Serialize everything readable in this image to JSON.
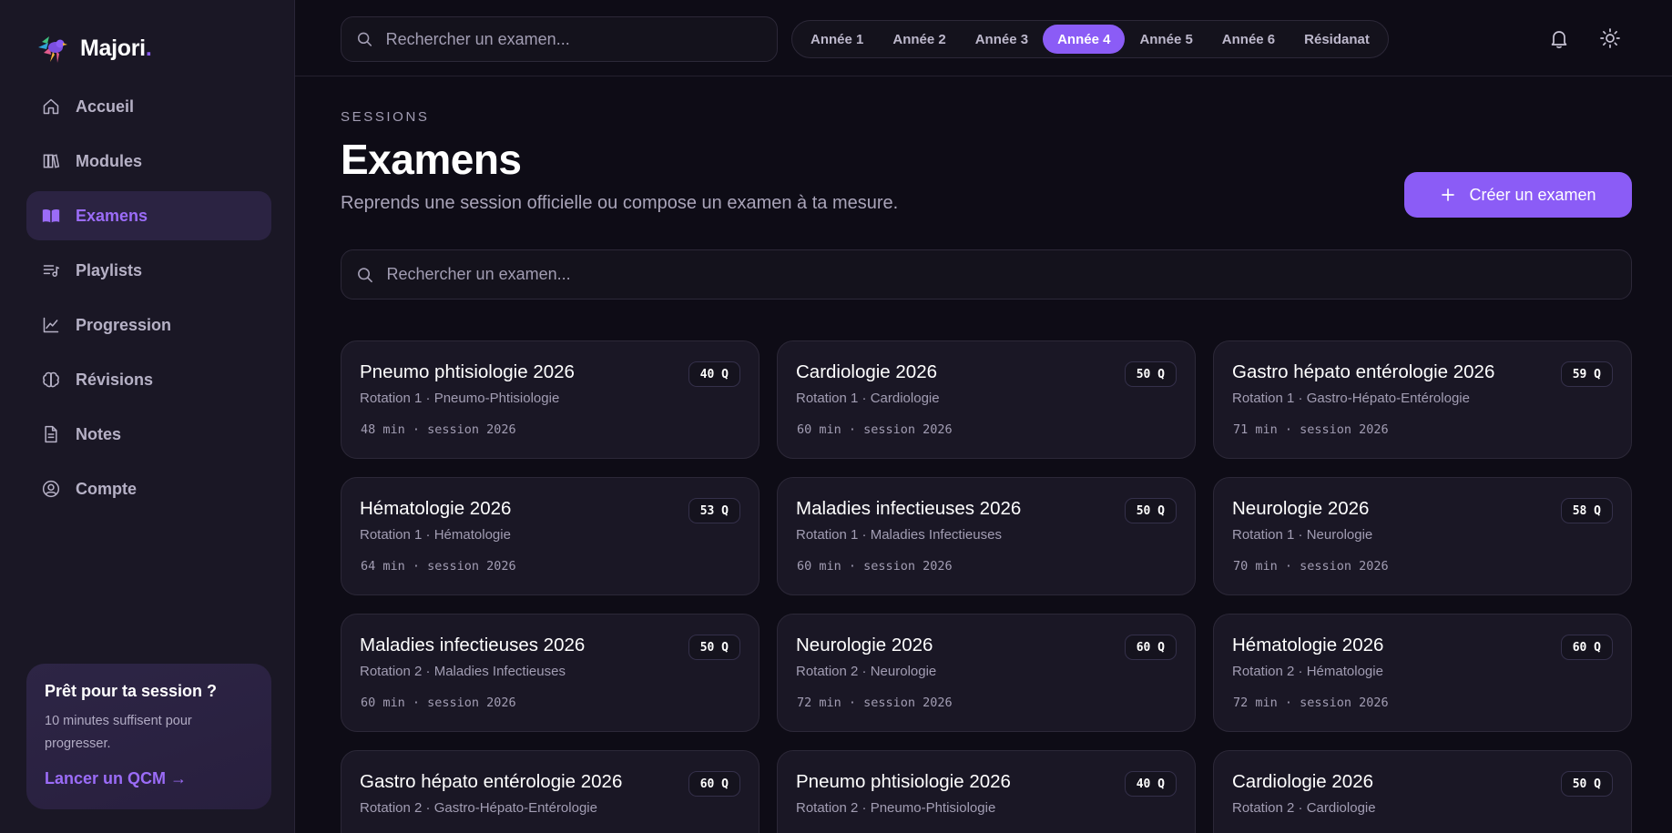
{
  "brand": {
    "name": "Majori",
    "dot": "."
  },
  "nav": [
    {
      "key": "accueil",
      "label": "Accueil",
      "icon": "home-icon",
      "active": false
    },
    {
      "key": "modules",
      "label": "Modules",
      "icon": "books-icon",
      "active": false
    },
    {
      "key": "examens",
      "label": "Examens",
      "icon": "open-book-icon",
      "active": true
    },
    {
      "key": "playlists",
      "label": "Playlists",
      "icon": "playlist-icon",
      "active": false
    },
    {
      "key": "progression",
      "label": "Progression",
      "icon": "chart-line-icon",
      "active": false
    },
    {
      "key": "revisions",
      "label": "Révisions",
      "icon": "brain-icon",
      "active": false
    },
    {
      "key": "notes",
      "label": "Notes",
      "icon": "document-icon",
      "active": false
    },
    {
      "key": "compte",
      "label": "Compte",
      "icon": "user-circle-icon",
      "active": false
    }
  ],
  "promo": {
    "title": "Prêt pour ta session ?",
    "text": "10 minutes suffisent pour progresser.",
    "link": "Lancer un QCM →"
  },
  "topbar": {
    "search_placeholder": "Rechercher un examen...",
    "years": [
      {
        "label": "Année 1",
        "active": false
      },
      {
        "label": "Année 2",
        "active": false
      },
      {
        "label": "Année 3",
        "active": false
      },
      {
        "label": "Année 4",
        "active": true
      },
      {
        "label": "Année 5",
        "active": false
      },
      {
        "label": "Année 6",
        "active": false
      },
      {
        "label": "Résidanat",
        "active": false
      }
    ]
  },
  "header": {
    "eyebrow": "SESSIONS",
    "title": "Examens",
    "subtitle": "Reprends une session officielle ou compose un examen à ta mesure.",
    "create_label": "Créer un examen"
  },
  "search": {
    "placeholder": "Rechercher un examen..."
  },
  "exams": [
    {
      "title": "Pneumo phtisiologie 2026",
      "subtitle": "Rotation 1 · Pneumo-Phtisiologie",
      "meta": "48 min · session 2026",
      "badge": "40 Q"
    },
    {
      "title": "Cardiologie 2026",
      "subtitle": "Rotation 1 · Cardiologie",
      "meta": "60 min · session 2026",
      "badge": "50 Q"
    },
    {
      "title": "Gastro hépato entérologie 2026",
      "subtitle": "Rotation 1 · Gastro-Hépato-Entérologie",
      "meta": "71 min · session 2026",
      "badge": "59 Q"
    },
    {
      "title": "Hématologie 2026",
      "subtitle": "Rotation 1 · Hématologie",
      "meta": "64 min · session 2026",
      "badge": "53 Q"
    },
    {
      "title": "Maladies infectieuses 2026",
      "subtitle": "Rotation 1 · Maladies Infectieuses",
      "meta": "60 min · session 2026",
      "badge": "50 Q"
    },
    {
      "title": "Neurologie 2026",
      "subtitle": "Rotation 1 · Neurologie",
      "meta": "70 min · session 2026",
      "badge": "58 Q"
    },
    {
      "title": "Maladies infectieuses 2026",
      "subtitle": "Rotation 2 · Maladies Infectieuses",
      "meta": "60 min · session 2026",
      "badge": "50 Q"
    },
    {
      "title": "Neurologie 2026",
      "subtitle": "Rotation 2 · Neurologie",
      "meta": "72 min · session 2026",
      "badge": "60 Q"
    },
    {
      "title": "Hématologie 2026",
      "subtitle": "Rotation 2 · Hématologie",
      "meta": "72 min · session 2026",
      "badge": "60 Q"
    },
    {
      "title": "Gastro hépato entérologie 2026",
      "subtitle": "Rotation 2 · Gastro-Hépato-Entérologie",
      "meta": "",
      "badge": "60 Q"
    },
    {
      "title": "Pneumo phtisiologie 2026",
      "subtitle": "Rotation 2 · Pneumo-Phtisiologie",
      "meta": "",
      "badge": "40 Q"
    },
    {
      "title": "Cardiologie 2026",
      "subtitle": "Rotation 2 · Cardiologie",
      "meta": "",
      "badge": "50 Q"
    }
  ],
  "colors": {
    "accent": "#8b5cf6",
    "background": "#0e0c16",
    "sidebar": "#1a1725"
  }
}
